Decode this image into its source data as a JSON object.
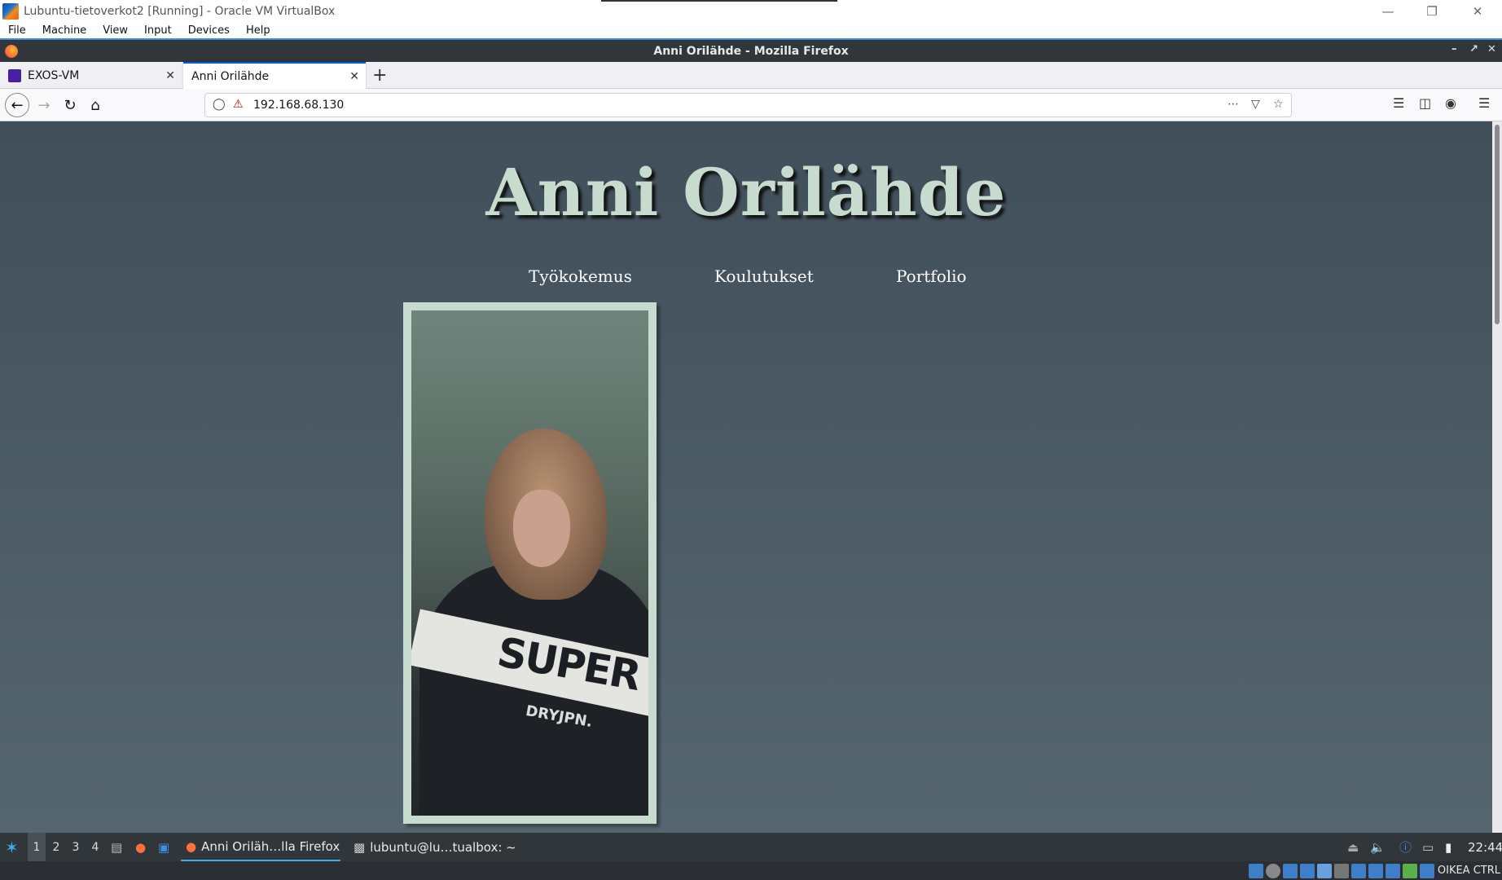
{
  "vbox": {
    "title": "Lubuntu-tietoverkot2 [Running] - Oracle VM VirtualBox",
    "menu": [
      "File",
      "Machine",
      "View",
      "Input",
      "Devices",
      "Help"
    ],
    "host_key": "OIKEA CTRL"
  },
  "firefox": {
    "window_title": "Anni Orilähde - Mozilla Firefox",
    "tabs": [
      {
        "label": "EXOS-VM",
        "active": false
      },
      {
        "label": "Anni Orilähde",
        "active": true
      }
    ],
    "url": "192.168.68.130"
  },
  "page": {
    "heading": "Anni Orilähde",
    "nav": [
      "Työkokemus",
      "Koulutukset",
      "Portfolio"
    ],
    "photo_text": "SUPER",
    "photo_subtext": "DRYJPN."
  },
  "panel": {
    "desktops": [
      "1",
      "2",
      "3",
      "4"
    ],
    "tasks": [
      {
        "label": "Anni Oriläh…lla Firefox",
        "active": true
      },
      {
        "label": "lubuntu@lu…tualbox: ~",
        "active": false
      }
    ],
    "clock": "22:44"
  },
  "colors": {
    "page_bg_top": "#404f5a",
    "page_bg_bottom": "#566670",
    "heading": "#c7dccf",
    "frame": "#c7dccf",
    "panel": "#31363b",
    "accent": "#0060df"
  }
}
